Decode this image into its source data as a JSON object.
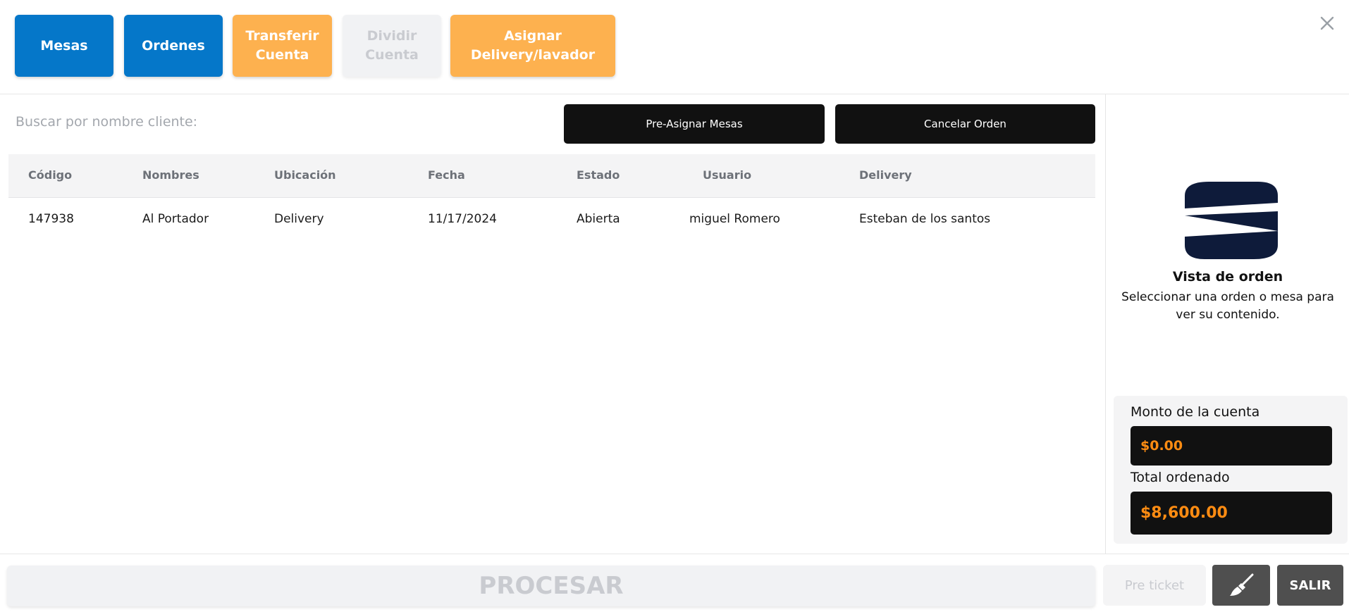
{
  "toolbar": {
    "mesas": "Mesas",
    "ordenes": "Ordenes",
    "transferir": "Transferir\nCuenta",
    "dividir": "Dividir\nCuenta",
    "asignar": "Asignar\nDelivery/lavador"
  },
  "search": {
    "label": "Buscar por nombre cliente:"
  },
  "actions": {
    "pre_asignar": "Pre-Asignar Mesas",
    "cancelar": "Cancelar Orden"
  },
  "table": {
    "headers": [
      "Código",
      "Nombres",
      "Ubicación",
      "Fecha",
      "Estado",
      "Usuario",
      "Delivery"
    ],
    "rows": [
      [
        "147938",
        "Al Portador",
        "Delivery",
        "11/17/2024",
        "Abierta",
        "miguel Romero",
        "Esteban de los santos"
      ]
    ]
  },
  "side": {
    "title": "Vista de orden",
    "description": "Seleccionar una orden o mesa para ver su contenido.",
    "monto_label": "Monto de la cuenta",
    "monto_value": "$0.00",
    "total_label": "Total ordenado",
    "total_value": "$8,600.00"
  },
  "bottom": {
    "procesar": "PROCESAR",
    "pre_ticket": "Pre ticket",
    "salir": "SALIR"
  },
  "icons": {
    "close": "close-icon",
    "brush": "brush-icon",
    "logo": "brand-logo"
  },
  "colors": {
    "blue": "#0577c9",
    "orange": "#fdb14f",
    "amount": "#ff8c12",
    "logo": "#0e1b3a"
  }
}
